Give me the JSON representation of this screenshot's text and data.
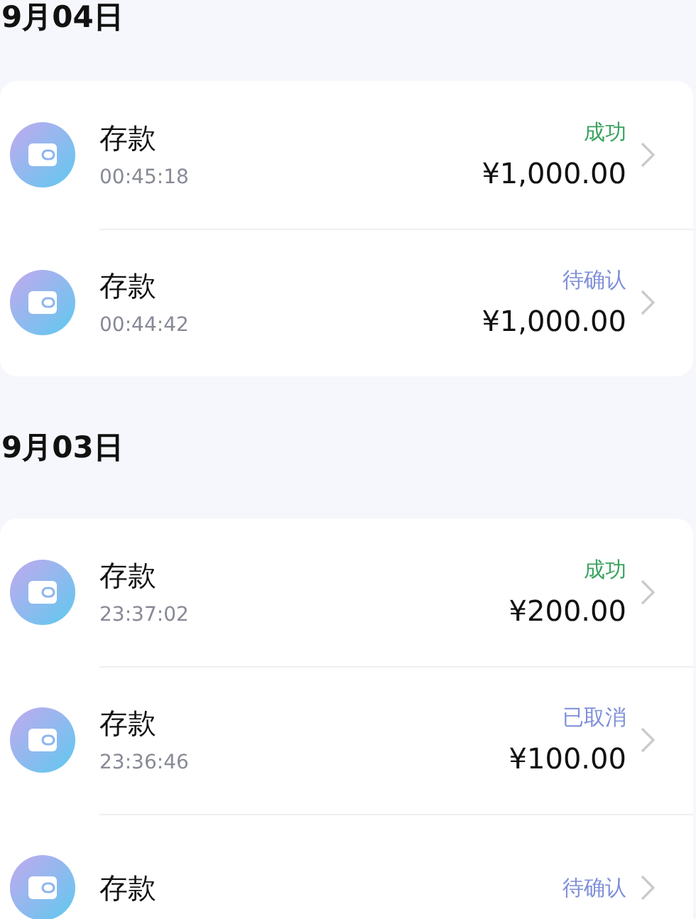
{
  "groups": [
    {
      "date": "9月04日",
      "records": [
        {
          "title": "存款",
          "time": "00:45:18",
          "status": "成功",
          "color": "#3aa35f",
          "amount": "¥1,000.00"
        },
        {
          "title": "存款",
          "time": "00:44:42",
          "status": "待确认",
          "color": "#7f8fd8",
          "amount": "¥1,000.00"
        }
      ]
    },
    {
      "date": "9月03日",
      "records": [
        {
          "title": "存款",
          "time": "23:37:02",
          "status": "成功",
          "color": "#3aa35f",
          "amount": "¥200.00"
        },
        {
          "title": "存款",
          "time": "23:36:46",
          "status": "已取消",
          "color": "#7f8fd8",
          "amount": "¥100.00"
        },
        {
          "title": "存款",
          "status": "待确认",
          "color": "#7f8fd8"
        }
      ]
    }
  ]
}
